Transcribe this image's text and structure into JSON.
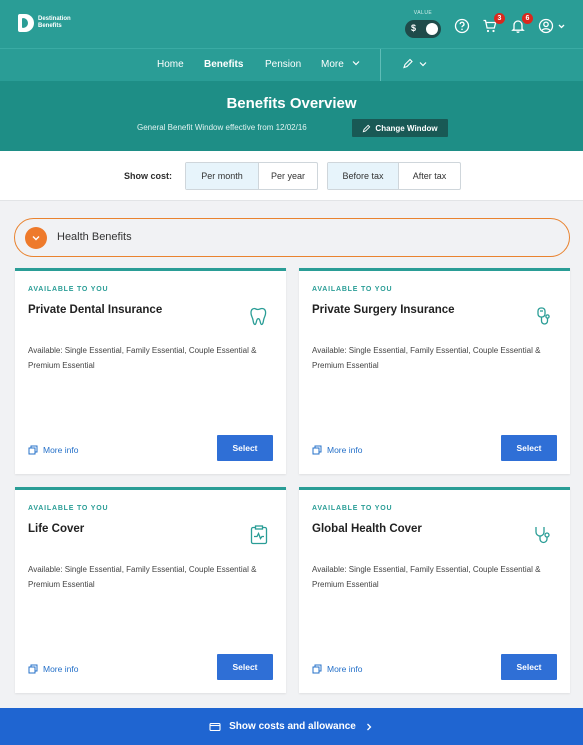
{
  "brand": {
    "logo_text": "Destination Benefits"
  },
  "topbar": {
    "value_label": "VALUE",
    "currency_symbol": "$",
    "cart_count": "3",
    "notifications_count": "6"
  },
  "nav": {
    "items": [
      "Home",
      "Benefits",
      "Pension",
      "More"
    ],
    "active": "Benefits"
  },
  "header": {
    "title": "Benefits Overview",
    "window_text": "General Benefit Window effective from 12/02/16",
    "change_window_label": "Change Window"
  },
  "cost_bar": {
    "label": "Show cost:",
    "period_options": [
      "Per month",
      "Per year"
    ],
    "period_selected": "Per month",
    "tax_options": [
      "Before tax",
      "After tax"
    ],
    "tax_selected": "Before tax"
  },
  "section": {
    "title": "Health Benefits"
  },
  "cards": [
    {
      "eyebrow": "AVAILABLE TO YOU",
      "title": "Private Dental Insurance",
      "icon": "tooth-icon",
      "description": "Available: Single Essential, Family Essential, Couple Essential & Premium Essential",
      "more_info": "More info",
      "select": "Select"
    },
    {
      "eyebrow": "AVAILABLE TO YOU",
      "title": "Private Surgery Insurance",
      "icon": "surgery-icon",
      "description": "Available: Single Essential, Family Essential, Couple Essential & Premium Essential",
      "more_info": "More info",
      "select": "Select"
    },
    {
      "eyebrow": "AVAILABLE TO YOU",
      "title": "Life Cover",
      "icon": "clipboard-pulse-icon",
      "description": "Available: Single Essential, Family Essential, Couple Essential & Premium Essential",
      "more_info": "More info",
      "select": "Select"
    },
    {
      "eyebrow": "AVAILABLE TO YOU",
      "title": "Global Health Cover",
      "icon": "stethoscope-icon",
      "description": "Available: Single Essential, Family Essential, Couple Essential & Premium Essential",
      "more_info": "More info",
      "select": "Select"
    }
  ],
  "footer": {
    "label": "Show costs and allowance"
  },
  "colors": {
    "teal": "#2a9d96",
    "teal_dark": "#1e8e86",
    "orange": "#ee7a2b",
    "blue": "#2f6fd6",
    "badge_red": "#d9281e"
  }
}
